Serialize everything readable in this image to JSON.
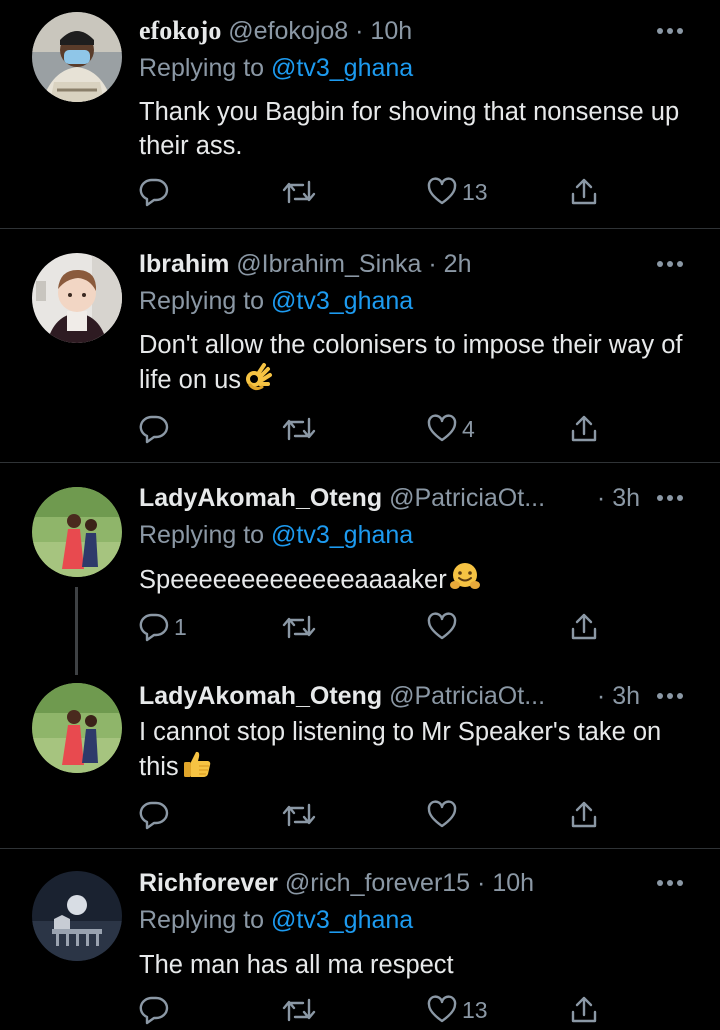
{
  "tweets": [
    {
      "name": "efokojo",
      "handle": "@efokojo8",
      "time": "10h",
      "replying_prefix": "Replying to",
      "replying_to": "@tv3_ghana",
      "text": "Thank you Bagbin for shoving that nonsense up their ass.",
      "reply_count": "",
      "retweet_count": "",
      "like_count": "13"
    },
    {
      "name": "Ibrahim",
      "handle": "@Ibrahim_Sinka",
      "time": "2h",
      "replying_prefix": "Replying to",
      "replying_to": "@tv3_ghana",
      "text": "Don't allow the colonisers to impose their way of life on us",
      "emoji": "ok-hand",
      "reply_count": "",
      "retweet_count": "",
      "like_count": "4"
    },
    {
      "name": "LadyAkomah_Oteng",
      "handle": "@PatriciaOt...",
      "time": "3h",
      "replying_prefix": "Replying to",
      "replying_to": "@tv3_ghana",
      "text": "Speeeeeeeeeeeeeaaaaker",
      "emoji": "hugging-face",
      "reply_count": "1",
      "retweet_count": "",
      "like_count": ""
    },
    {
      "name": "LadyAkomah_Oteng",
      "handle": "@PatriciaOt...",
      "time": "3h",
      "text": "I cannot stop listening to Mr Speaker's take on this",
      "emoji": "thumbs-up",
      "reply_count": "",
      "retweet_count": "",
      "like_count": ""
    },
    {
      "name": "Richforever",
      "handle": "@rich_forever15",
      "time": "10h",
      "replying_prefix": "Replying to",
      "replying_to": "@tv3_ghana",
      "text": "The man has all ma respect",
      "reply_count": "",
      "retweet_count": "",
      "like_count": "13"
    }
  ],
  "separator": "·",
  "colors": {
    "background": "#000000",
    "text": "#e7e9ea",
    "secondary": "#8b98a5",
    "link": "#1d9bf0",
    "divider": "#2f3336"
  }
}
